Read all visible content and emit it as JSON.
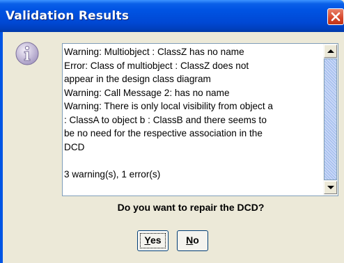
{
  "window": {
    "title": "Validation Results"
  },
  "message_lines": [
    "Warning: Multiobject  : ClassZ has no name",
    "Error: Class of multiobject  : ClassZ does not",
    "appear in the design class diagram",
    "Warning: Call Message 2:  has no name",
    "Warning: There is only local visibility from object a",
    ": ClassA to object b : ClassB and there seems to",
    "be  no need for the respective association in the",
    "DCD",
    "",
    "3 warning(s), 1 error(s)"
  ],
  "question": "Do you want to repair the DCD?",
  "buttons": {
    "yes_mnemonic": "Y",
    "yes_rest": "es",
    "no_mnemonic": "N",
    "no_rest": "o"
  },
  "icons": {
    "dialog": "information-icon",
    "close": "close-icon"
  },
  "colors": {
    "titlebar": "#0054e3",
    "close": "#d6462a",
    "background": "#ece9d8"
  }
}
